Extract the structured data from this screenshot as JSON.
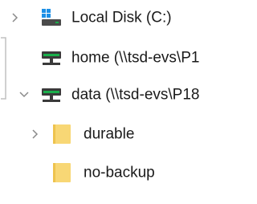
{
  "tree": {
    "items": [
      {
        "label": "Local Disk (C:)",
        "icon": "local-disk-icon",
        "expander": "chevron-right-icon"
      },
      {
        "label": "home (\\\\tsd-evs\\P1",
        "icon": "network-drive-icon",
        "expander": "none"
      },
      {
        "label": "data (\\\\tsd-evs\\P18",
        "icon": "network-drive-icon",
        "expander": "chevron-down-icon"
      },
      {
        "label": "durable",
        "icon": "folder-icon",
        "expander": "chevron-right-icon"
      },
      {
        "label": "no-backup",
        "icon": "folder-icon",
        "expander": "none"
      }
    ]
  },
  "colors": {
    "folder_fill": "#F8D775",
    "folder_shade": "#EEC34E",
    "drive_body": "#3a3a3a",
    "drive_light": "#1AAF4B",
    "windows_blue": "#1E90E6",
    "chevron": "#8a8a8a",
    "scroll_outline": "#c0c0c0"
  }
}
